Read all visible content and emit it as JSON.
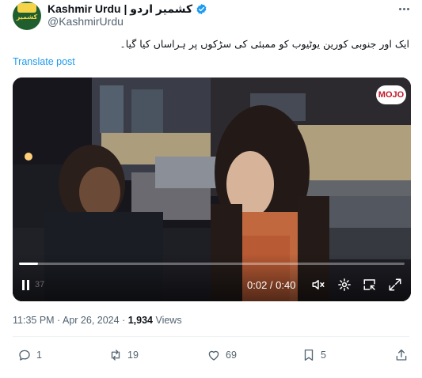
{
  "author": {
    "display_name": "Kashmir Urdu | کشمیر اردو",
    "handle": "@KashmirUrdu",
    "avatar_text": "کشمیر",
    "verified": true,
    "verified_color": "#1d9bf0"
  },
  "post": {
    "text": "ایک اور جنوبی کورین یوٹیوب کو ممبئی کی سڑکوں پر ہراساں کیا گیا۔",
    "translate_label": "Translate post"
  },
  "video": {
    "logo_text": "MOJO",
    "current_time": "0:02",
    "duration": "0:40",
    "time_separator": " / ",
    "ghost_time": "37",
    "progress": 0.05,
    "controls": [
      "pause-icon",
      "volume-muted-icon",
      "gear-icon",
      "picture-in-picture-icon",
      "fullscreen-icon"
    ]
  },
  "meta": {
    "time": "11:35 PM",
    "dot": " · ",
    "date": "Apr 26, 2024",
    "views_count": "1,934",
    "views_label": "Views"
  },
  "actions": {
    "replies": "1",
    "reposts": "19",
    "likes": "69",
    "bookmarks": "5"
  },
  "colors": {
    "link": "#1d9bf0",
    "secondary_text": "#536471",
    "primary_text": "#0f1419"
  }
}
